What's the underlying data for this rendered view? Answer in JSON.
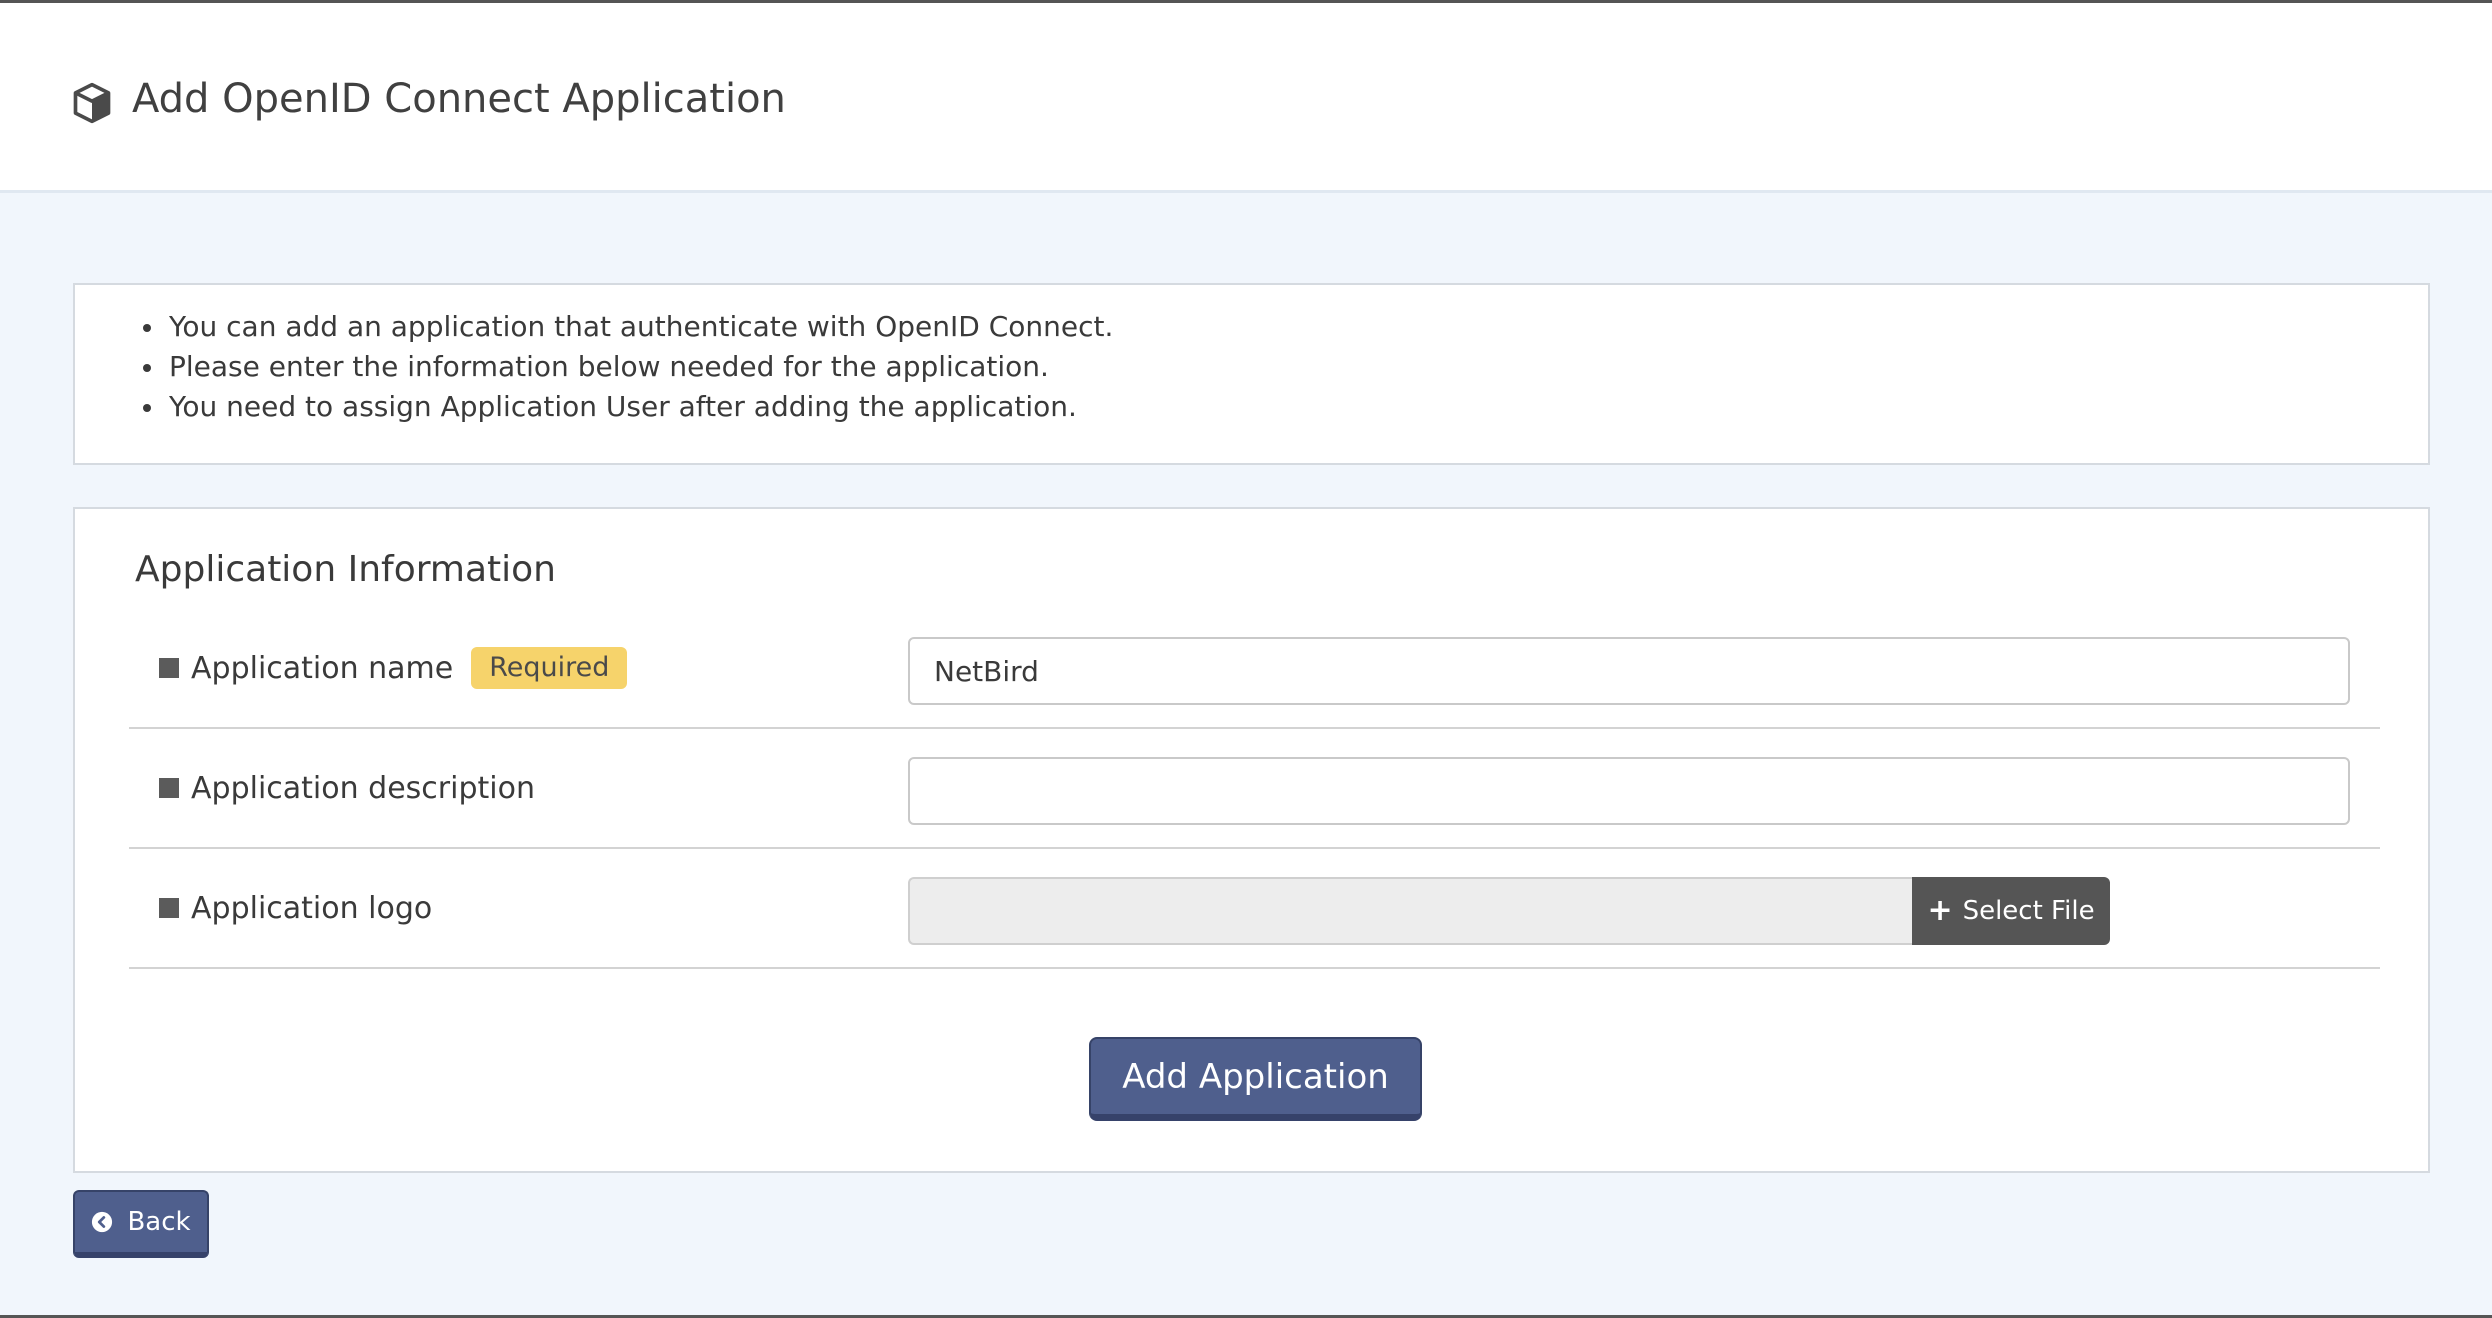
{
  "header": {
    "title": "Add OpenID Connect Application",
    "icon": "cube-icon"
  },
  "notice": {
    "items": [
      "You can add an application that authenticate with OpenID Connect.",
      "Please enter the information below needed for the application.",
      "You need to assign Application User after adding the application."
    ]
  },
  "form": {
    "section_title": "Application Information",
    "fields": {
      "name": {
        "label": "Application name",
        "badge": "Required",
        "value": "NetBird"
      },
      "description": {
        "label": "Application description",
        "value": ""
      },
      "logo": {
        "label": "Application logo",
        "button_label": "Select File"
      }
    },
    "submit_label": "Add Application"
  },
  "footer": {
    "back_label": "Back"
  },
  "colors": {
    "primary": "#4f5f8d",
    "badge": "#f6d36b",
    "background": "#f1f6fc",
    "dark_button": "#555555"
  }
}
